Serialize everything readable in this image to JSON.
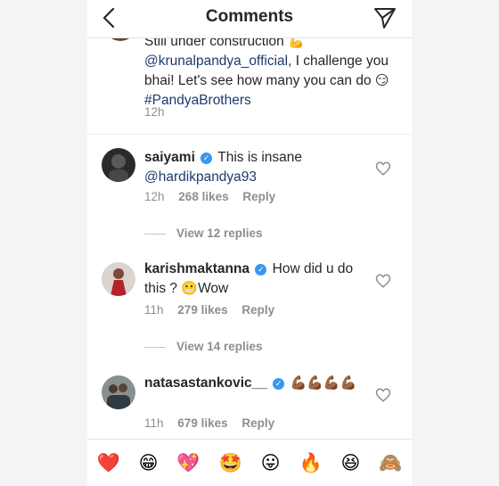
{
  "header": {
    "title": "Comments",
    "back_icon": "chevron-left-icon",
    "send_icon": "paper-plane-icon"
  },
  "caption": {
    "line1_text": "Still under construction",
    "line1_emoji": "💪",
    "mention": "@krunalpandya_official",
    "text2": ", I challenge you bhai! Let's see how many you can do",
    "emoji2": "😏",
    "hashtag": "#PandyaBrothers",
    "time": "12h"
  },
  "comments": [
    {
      "username": "saiyami",
      "text": "This is insane",
      "mention": "@hardikpandya93",
      "time": "12h",
      "likes": "268 likes",
      "reply": "Reply",
      "view_replies": "View 12 replies"
    },
    {
      "username": "karishmaktanna",
      "text": "How did u do this ?",
      "emoji": "😬",
      "text2": "Wow",
      "time": "11h",
      "likes": "279 likes",
      "reply": "Reply",
      "view_replies": "View 14 replies"
    },
    {
      "username": "natasastankovic__",
      "emoji": "💪🏾💪🏾💪🏾💪🏾",
      "time": "11h",
      "likes": "679 likes",
      "reply": "Reply"
    }
  ],
  "emoji_bar": [
    "❤️",
    "😁",
    "💖",
    "🤩",
    "😛",
    "🔥",
    "😆",
    "🙈"
  ],
  "colors": {
    "mention": "#1d3a6e",
    "verified": "#3897f0",
    "meta": "#8e8e8e"
  }
}
